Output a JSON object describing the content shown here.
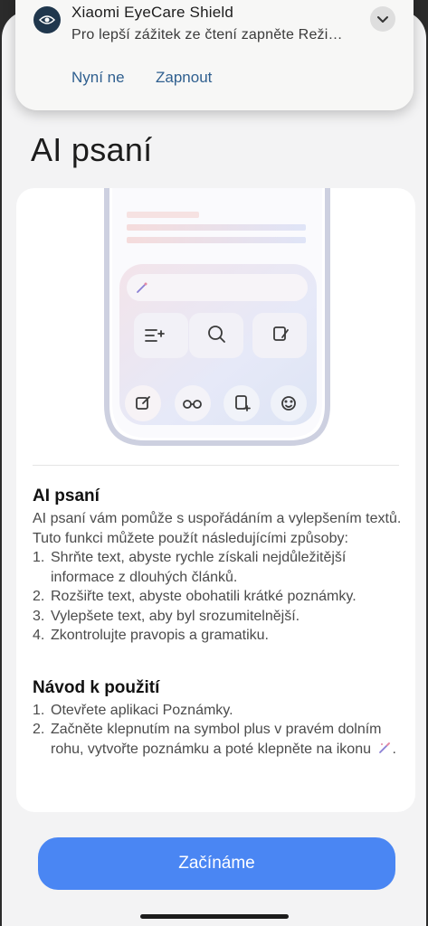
{
  "notification": {
    "app_name": "Xiaomi EyeCare Shield",
    "message": "Pro lepší zážitek ze čtení zapněte Reži…",
    "icon": "eye-icon",
    "dismiss_label": "Nyní ne",
    "enable_label": "Zapnout"
  },
  "page": {
    "title": "AI psaní"
  },
  "feature": {
    "heading": "AI psaní",
    "intro": "AI psaní vám pomůže s uspořádáním a vylepšením textů. Tuto funkci můžete použít následujícími způsoby:",
    "items": [
      {
        "num": "1.",
        "text": "Shrňte text, abyste rychle získali nejdůležitější informace z dlouhých článků."
      },
      {
        "num": "2.",
        "text": "Rozšiřte text, abyste obohatili krátké poznámky."
      },
      {
        "num": "3.",
        "text": "Vylepšete text, aby byl srozumitelnější."
      },
      {
        "num": "4.",
        "text": "Zkontrolujte pravopis a gramatiku."
      }
    ]
  },
  "guide": {
    "heading": "Návod k použití",
    "step1_num": "1.",
    "step1": "Otevřete aplikaci Poznámky.",
    "step2_num": "2.",
    "step2": "Začněte klepnutím na symbol plus v pravém dolním rohu, vytvořte poznámku a poté klepněte na ikonu",
    "step2_end": "."
  },
  "cta": {
    "label": "Začínáme"
  },
  "colors": {
    "accent": "#4a86f3",
    "notif_action": "#2f5f8f"
  }
}
